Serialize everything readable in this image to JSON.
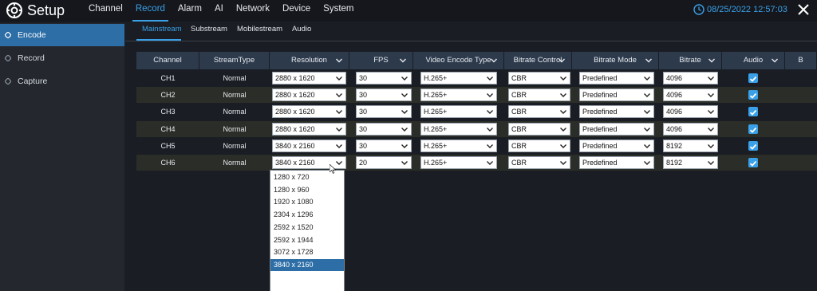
{
  "app": {
    "title": "Setup",
    "datetime": "08/25/2022 12:57:03"
  },
  "topnav": [
    {
      "label": "Channel",
      "active": false
    },
    {
      "label": "Record",
      "active": true
    },
    {
      "label": "Alarm",
      "active": false
    },
    {
      "label": "AI",
      "active": false
    },
    {
      "label": "Network",
      "active": false
    },
    {
      "label": "Device",
      "active": false
    },
    {
      "label": "System",
      "active": false
    }
  ],
  "sidebar": [
    {
      "label": "Encode",
      "active": true
    },
    {
      "label": "Record",
      "active": false
    },
    {
      "label": "Capture",
      "active": false
    }
  ],
  "subtabs": [
    {
      "label": "Mainstream",
      "active": true
    },
    {
      "label": "Substream",
      "active": false
    },
    {
      "label": "Mobilestream",
      "active": false
    },
    {
      "label": "Audio",
      "active": false
    }
  ],
  "columns": [
    "Channel",
    "StreamType",
    "Resolution",
    "FPS",
    "Video Encode Type",
    "Bitrate Control",
    "Bitrate Mode",
    "Bitrate",
    "Audio",
    "B"
  ],
  "rows": [
    {
      "channel": "CH1",
      "stream_type": "Normal",
      "resolution": "2880 x 1620",
      "fps": "30",
      "encode": "H.265+",
      "bitrate_control": "CBR",
      "bitrate_mode": "Predefined",
      "bitrate": "4096",
      "audio": true
    },
    {
      "channel": "CH2",
      "stream_type": "Normal",
      "resolution": "2880 x 1620",
      "fps": "30",
      "encode": "H.265+",
      "bitrate_control": "CBR",
      "bitrate_mode": "Predefined",
      "bitrate": "4096",
      "audio": true
    },
    {
      "channel": "CH3",
      "stream_type": "Normal",
      "resolution": "2880 x 1620",
      "fps": "30",
      "encode": "H.265+",
      "bitrate_control": "CBR",
      "bitrate_mode": "Predefined",
      "bitrate": "4096",
      "audio": true
    },
    {
      "channel": "CH4",
      "stream_type": "Normal",
      "resolution": "2880 x 1620",
      "fps": "30",
      "encode": "H.265+",
      "bitrate_control": "CBR",
      "bitrate_mode": "Predefined",
      "bitrate": "4096",
      "audio": true
    },
    {
      "channel": "CH5",
      "stream_type": "Normal",
      "resolution": "3840 x 2160",
      "fps": "30",
      "encode": "H.265+",
      "bitrate_control": "CBR",
      "bitrate_mode": "Predefined",
      "bitrate": "8192",
      "audio": true
    },
    {
      "channel": "CH6",
      "stream_type": "Normal",
      "resolution": "3840 x 2160",
      "fps": "20",
      "encode": "H.265+",
      "bitrate_control": "CBR",
      "bitrate_mode": "Predefined",
      "bitrate": "8192",
      "audio": true
    }
  ],
  "resolution_dropdown": {
    "options": [
      "1280 x 720",
      "1280 x 960",
      "1920 x 1080",
      "2304 x 1296",
      "2592 x 1520",
      "2592 x 1944",
      "3072 x 1728",
      "3840 x 2160"
    ],
    "selected": "3840 x 2160"
  },
  "colors": {
    "accent": "#3aa0e8",
    "sidebar_active": "#2d6ea6",
    "header_bg": "#2c3a4c"
  }
}
